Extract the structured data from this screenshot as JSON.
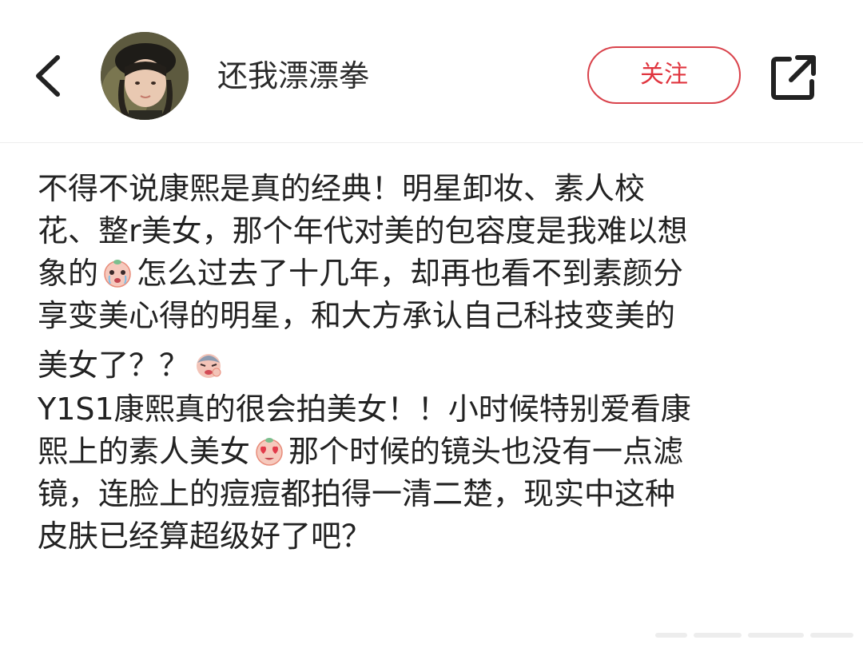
{
  "header": {
    "username": "还我漂漂拳",
    "follow_label": "关注",
    "avatar_icon": "user-avatar-photo",
    "back_icon": "chevron-left-icon",
    "share_icon": "share-external-icon",
    "accent_color": "#e0353f"
  },
  "post": {
    "lines": [
      "不得不说康熙是真的经典！明星卸妆、素人校",
      "花、整r美女，那个年代对美的包容度是我难以想",
      "象的",
      "怎么过去了十几年，却再也看不到素颜分",
      "享变美心得的明星，和大方承认自己科技变美的",
      "美女了？？",
      "Y1S1康熙真的很会拍美女！！小时候特别爱看康",
      "熙上的素人美女",
      "那个时候的镜头也没有一点滤",
      "镜，连脸上的痘痘都拍得一清二楚，现实中这种",
      "皮肤已经算超级好了吧？"
    ],
    "emojis": [
      "crying-face-emoji",
      "pouting-face-emoji",
      "heart-eyes-emoji"
    ]
  }
}
